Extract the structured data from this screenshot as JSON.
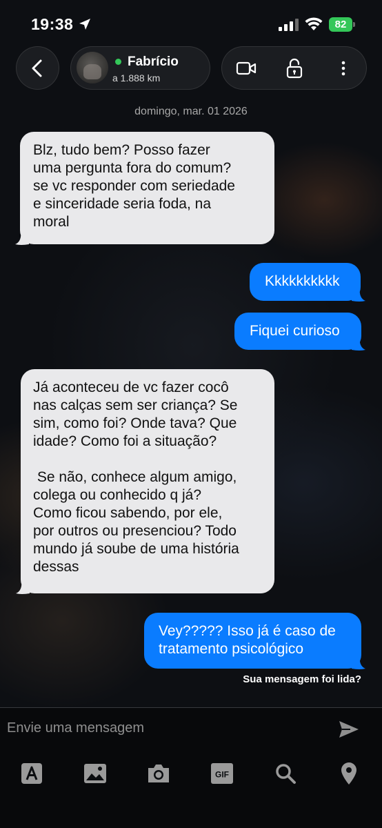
{
  "status_bar": {
    "time": "19:38",
    "battery": "82"
  },
  "header": {
    "contact_name": "Fabrício",
    "distance": "a 1.888 km",
    "online_color": "#34c759"
  },
  "conversation": {
    "date": "domingo, mar. 01 2026",
    "messages": [
      {
        "direction": "in",
        "text": "Blz, tudo bem? Posso fazer\numa pergunta fora do comum?\nse vc responder com seriedade\ne sinceridade seria foda, na\nmoral"
      },
      {
        "direction": "out",
        "text": "Kkkkkkkkkk"
      },
      {
        "direction": "out",
        "text": "Fiquei curioso"
      },
      {
        "direction": "in",
        "text": "Já aconteceu de vc fazer cocô\nnas calças sem ser criança? Se\nsim, como foi? Onde tava? Que\nidade? Como foi a situação?\n\n Se não, conhece algum amigo,\ncolega ou conhecido q já?\nComo ficou sabendo, por ele,\npor outros ou presenciou? Todo\nmundo já soube de uma história\ndessas"
      },
      {
        "direction": "out",
        "text": "Vey????? Isso já é caso de\ntratamento psicológico"
      }
    ],
    "read_receipt": "Sua mensagem foi lida?"
  },
  "composer": {
    "placeholder": "Envie uma mensagem",
    "gif_label": "GIF"
  },
  "colors": {
    "outgoing_bubble": "#0a7cff",
    "incoming_bubble": "#e9e9eb"
  }
}
